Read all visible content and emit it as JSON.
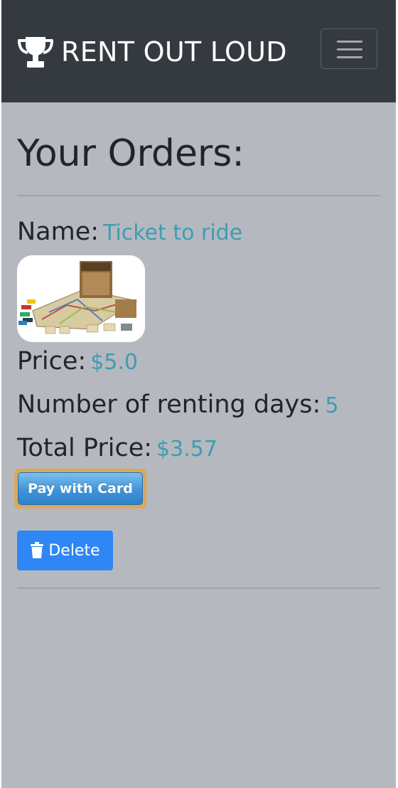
{
  "navbar": {
    "brand": "RENT OUT LOUD",
    "brand_icon": "trophy-icon",
    "toggler_icon": "hamburger-menu-icon"
  },
  "page": {
    "title": "Your Orders:"
  },
  "order": {
    "name_label": "Name:",
    "name_value": "Ticket to ride",
    "price_label": "Price:",
    "price_value": "$5.0",
    "days_label": "Number of renting days:",
    "days_value": "5",
    "total_label": "Total Price:",
    "total_value": "$3.57",
    "pay_button": "Pay with Card",
    "delete_button": "Delete",
    "delete_icon": "trash-icon"
  },
  "colors": {
    "navbar_bg": "#343a40",
    "page_bg": "#b5b9bf",
    "value_text": "#3f9cb3",
    "delete_button": "#2f86f5",
    "pay_button": "#3f93d8"
  }
}
